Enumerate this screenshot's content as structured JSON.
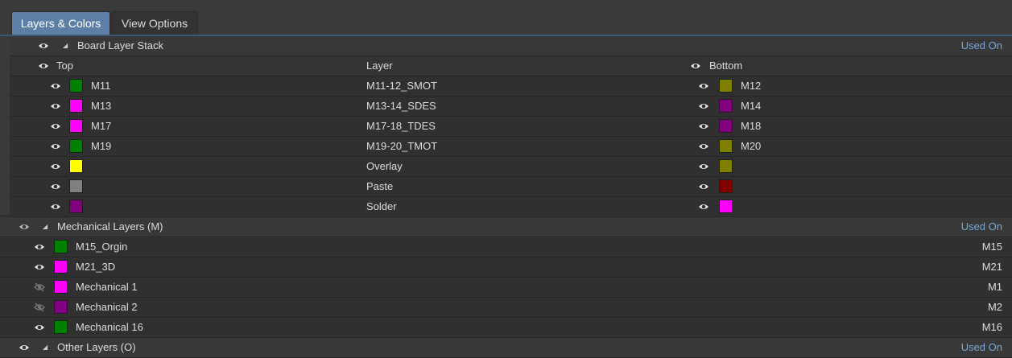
{
  "tabs": {
    "active": "Layers & Colors",
    "inactive": "View Options"
  },
  "used_on": "Used On",
  "board_stack": {
    "title": "Board Layer Stack",
    "headers": {
      "top": "Top",
      "layer": "Layer",
      "bottom": "Bottom"
    },
    "rows": [
      {
        "top": "M11",
        "top_color": "#008000",
        "layer": "M11-12_SMOT",
        "bottom": "M12",
        "bottom_color": "#808000"
      },
      {
        "top": "M13",
        "top_color": "#ff00ff",
        "layer": "M13-14_SDES",
        "bottom": "M14",
        "bottom_color": "#800080"
      },
      {
        "top": "M17",
        "top_color": "#ff00ff",
        "layer": "M17-18_TDES",
        "bottom": "M18",
        "bottom_color": "#800080"
      },
      {
        "top": "M19",
        "top_color": "#008000",
        "layer": "M19-20_TMOT",
        "bottom": "M20",
        "bottom_color": "#808000"
      },
      {
        "top": "",
        "top_color": "#ffff00",
        "layer": "Overlay",
        "bottom": "",
        "bottom_color": "#808000"
      },
      {
        "top": "",
        "top_color": "#808080",
        "layer": "Paste",
        "bottom": "",
        "bottom_color": "#800000"
      },
      {
        "top": "",
        "top_color": "#800080",
        "layer": "Solder",
        "bottom": "",
        "bottom_color": "#ff00ff"
      }
    ]
  },
  "mechanical": {
    "title": "Mechanical Layers (M)",
    "rows": [
      {
        "name": "M15_Orgin",
        "color": "#008000",
        "code": "M15",
        "visible": true
      },
      {
        "name": "M21_3D",
        "color": "#ff00ff",
        "code": "M21",
        "visible": true
      },
      {
        "name": "Mechanical 1",
        "color": "#ff00ff",
        "code": "M1",
        "visible": false
      },
      {
        "name": "Mechanical 2",
        "color": "#800080",
        "code": "M2",
        "visible": false
      },
      {
        "name": "Mechanical 16",
        "color": "#008000",
        "code": "M16",
        "visible": true
      }
    ]
  },
  "other": {
    "title": "Other Layers (O)"
  },
  "icons": {
    "eye": "eye-icon",
    "eye_hidden": "eye-off-icon",
    "collapse": "collapse-triangle-icon"
  }
}
